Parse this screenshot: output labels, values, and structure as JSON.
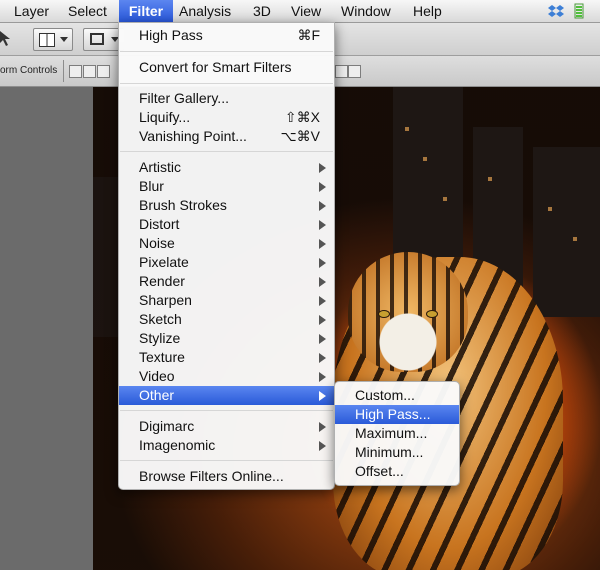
{
  "menubar": {
    "items": [
      "Layer",
      "Select",
      "Filter",
      "Analysis",
      "3D",
      "View",
      "Window",
      "Help"
    ],
    "active": "Filter"
  },
  "toolbar": {
    "transform_controls_label": "orm Controls"
  },
  "filter_menu": {
    "last_filter": {
      "label": "High Pass",
      "shortcut": "⌘F"
    },
    "convert": "Convert for Smart Filters",
    "group2": [
      {
        "label": "Filter Gallery...",
        "shortcut": ""
      },
      {
        "label": "Liquify...",
        "shortcut": "⇧⌘X"
      },
      {
        "label": "Vanishing Point...",
        "shortcut": "⌥⌘V"
      }
    ],
    "categories": [
      "Artistic",
      "Blur",
      "Brush Strokes",
      "Distort",
      "Noise",
      "Pixelate",
      "Render",
      "Sharpen",
      "Sketch",
      "Stylize",
      "Texture",
      "Video",
      "Other"
    ],
    "selected_category": "Other",
    "plugins": [
      "Digimarc",
      "Imagenomic"
    ],
    "browse": "Browse Filters Online..."
  },
  "other_submenu": {
    "items": [
      "Custom...",
      "High Pass...",
      "Maximum...",
      "Minimum...",
      "Offset..."
    ],
    "selected": "High Pass..."
  },
  "colors": {
    "menu_highlight": "#2a5ad8",
    "menubar_bg": "#e6e6e6"
  },
  "icons": [
    "dropbox-icon",
    "battery-status-icon",
    "arrow-tool-icon",
    "arrange-documents-icon",
    "screen-mode-icon",
    "submenu-arrow-icon"
  ]
}
